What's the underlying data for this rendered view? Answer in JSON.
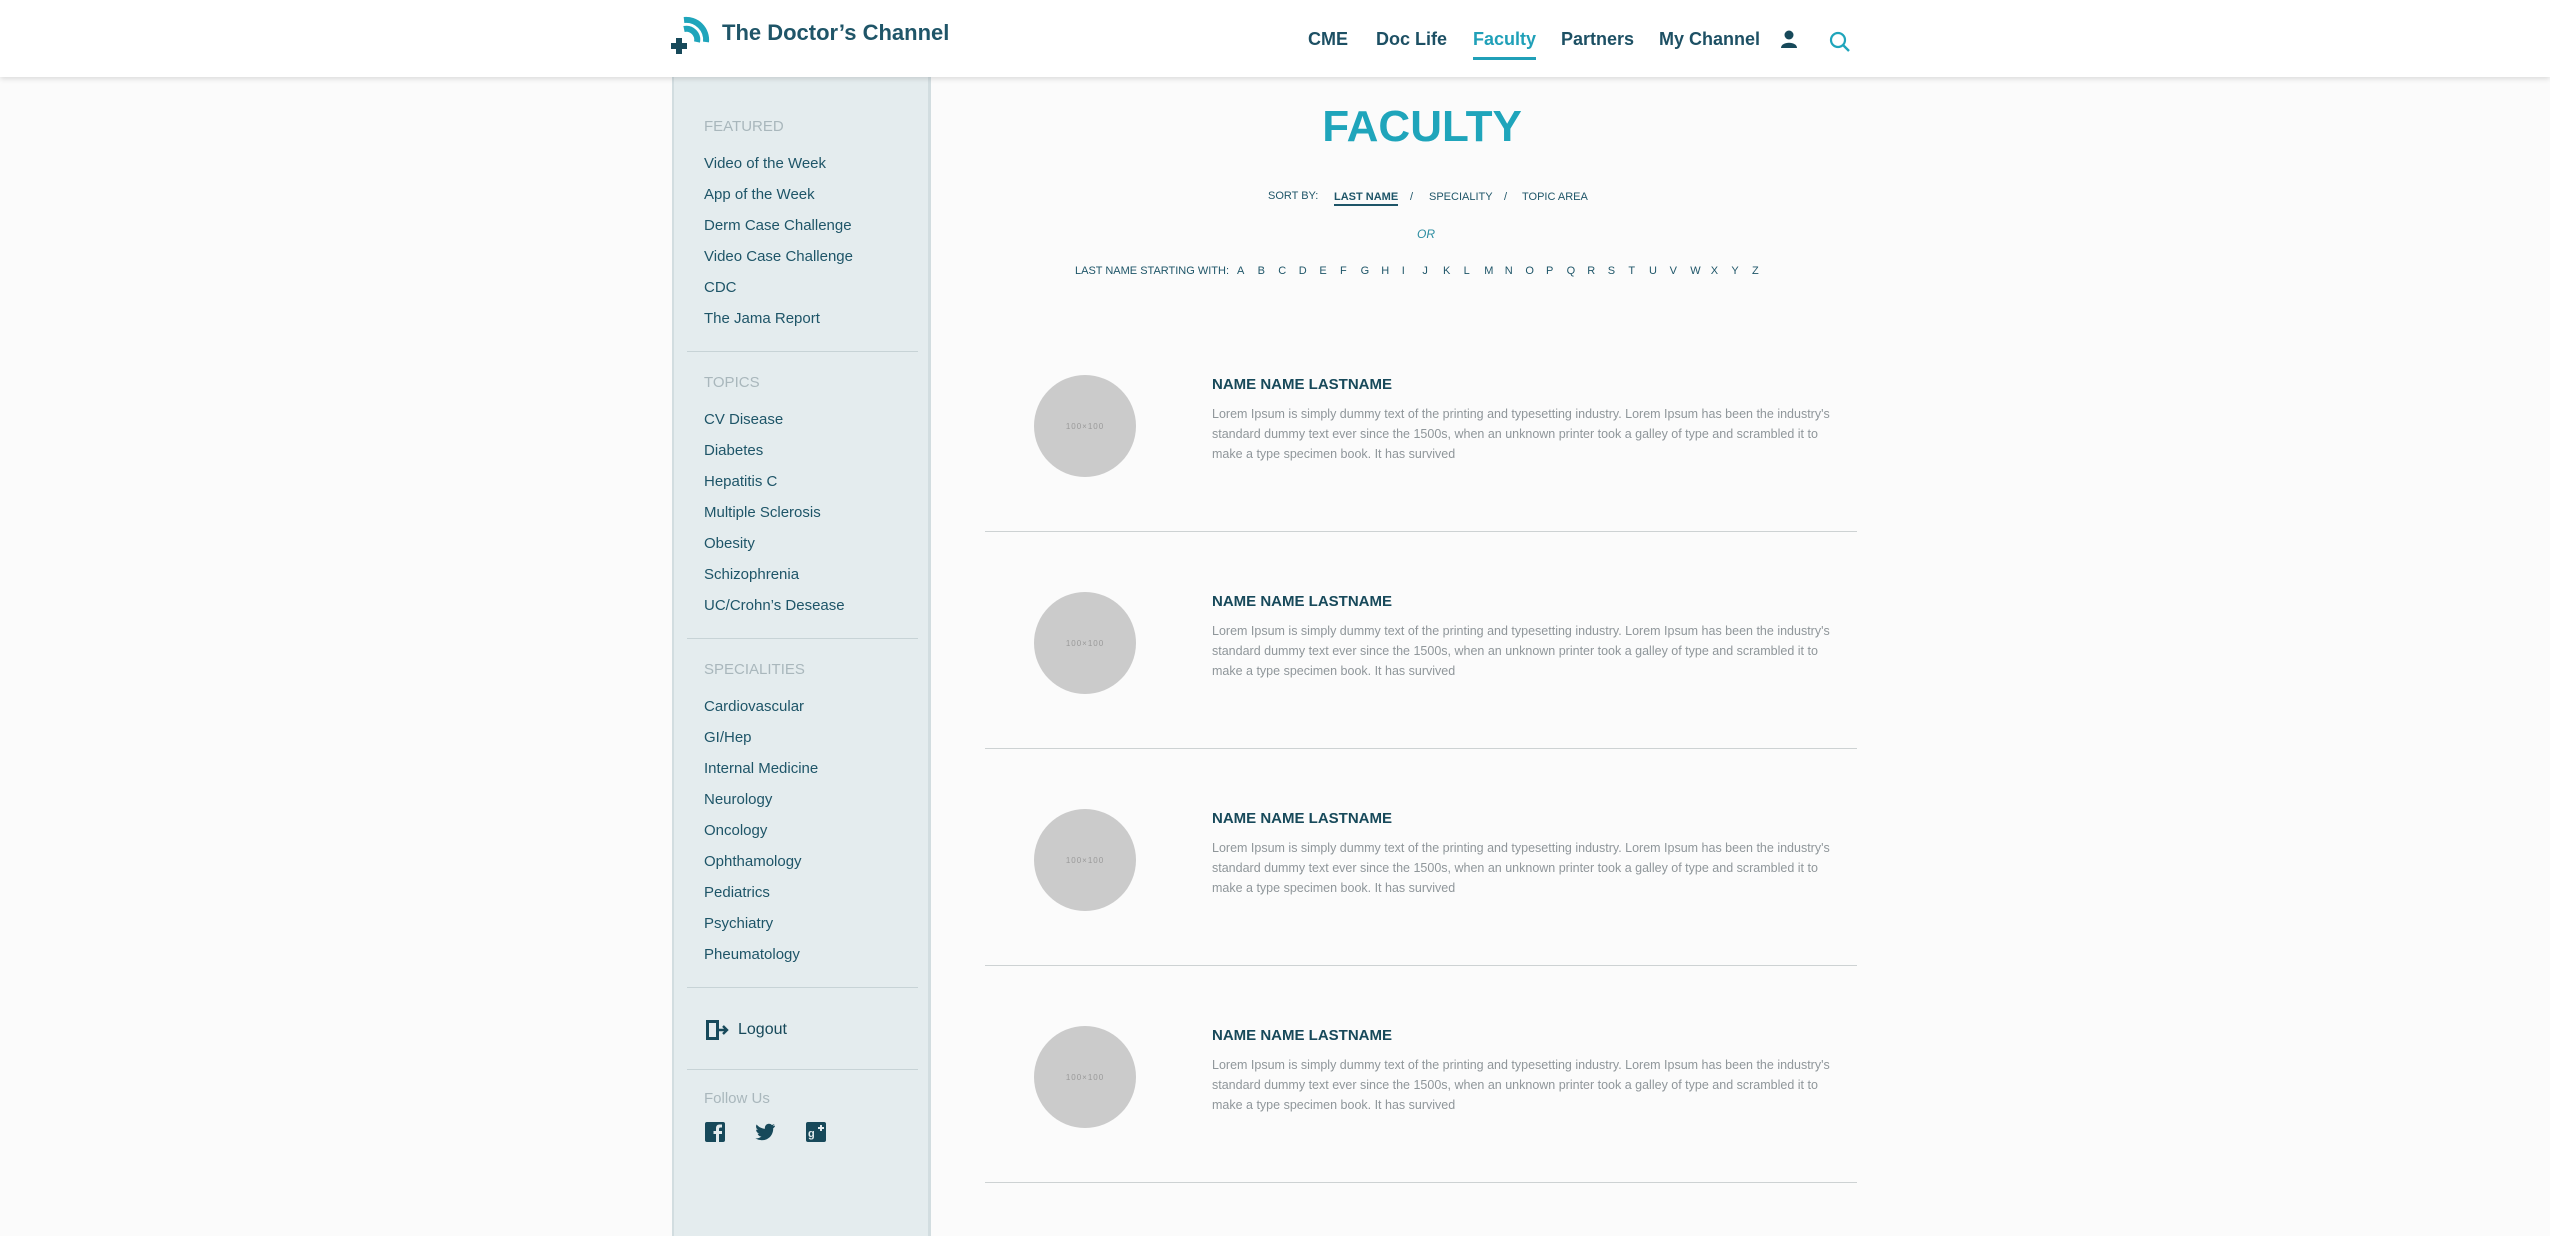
{
  "header": {
    "logo_text": "The Doctor’s Channel",
    "nav": [
      {
        "label": "CME"
      },
      {
        "label": "Doc Life"
      },
      {
        "label": "Faculty",
        "active": true
      },
      {
        "label": "Partners"
      },
      {
        "label": "My Channel"
      }
    ],
    "icons": [
      "user-icon",
      "search-icon"
    ]
  },
  "sidebar": {
    "featured": {
      "heading": "FEATURED",
      "items": [
        "Video of the Week",
        "App of the Week",
        "Derm Case Challenge",
        "Video Case Challenge",
        "CDC",
        "The Jama Report"
      ]
    },
    "topics": {
      "heading": "TOPICS",
      "items": [
        "CV Disease",
        "Diabetes",
        "Hepatitis C",
        "Multiple Sclerosis",
        "Obesity",
        "Schizophrenia",
        "UC/Crohn’s Desease"
      ]
    },
    "specialities": {
      "heading": "SPECIALITIES",
      "items": [
        "Cardiovascular",
        "GI/Hep",
        "Internal Medicine",
        "Neurology",
        "Oncology",
        "Ophthamology",
        "Pediatrics",
        "Psychiatry",
        "Pheumatology"
      ]
    },
    "logout_label": "Logout",
    "follow_label": "Follow Us",
    "social_icons": [
      "facebook-icon",
      "twitter-icon",
      "google-plus-icon"
    ]
  },
  "main": {
    "title": "FACULTY",
    "sort": {
      "label": "SORT BY:",
      "options": [
        {
          "label": "LAST NAME",
          "active": true
        },
        {
          "label": "SPECIALITY"
        },
        {
          "label": "TOPIC AREA"
        }
      ],
      "separator": "/"
    },
    "or_text": "OR",
    "alpha": {
      "label": "LAST NAME STARTING WITH:",
      "letters": [
        "A",
        "B",
        "C",
        "D",
        "E",
        "F",
        "G",
        "H",
        "I",
        "J",
        "K",
        "L",
        "M",
        "N",
        "O",
        "P",
        "Q",
        "R",
        "S",
        "T",
        "U",
        "V",
        "W",
        "X",
        "Y",
        "Z"
      ]
    },
    "faculty": [
      {
        "name": "NAME NAME LASTNAME",
        "avatar_text": "100×100",
        "bio": "Lorem Ipsum is simply dummy text of the printing and typesetting industry. Lorem Ipsum has been the industry's standard dummy text ever since the 1500s, when an unknown printer took a galley of type and scrambled it to make a type specimen book. It has survived"
      },
      {
        "name": "NAME NAME LASTNAME",
        "avatar_text": "100×100",
        "bio": "Lorem Ipsum is simply dummy text of the printing and typesetting industry. Lorem Ipsum has been the industry's standard dummy text ever since the 1500s, when an unknown printer took a galley of type and scrambled it to make a type specimen book. It has survived"
      },
      {
        "name": "NAME NAME LASTNAME",
        "avatar_text": "100×100",
        "bio": "Lorem Ipsum is simply dummy text of the printing and typesetting industry. Lorem Ipsum has been the industry's standard dummy text ever since the 1500s, when an unknown printer took a galley of type and scrambled it to make a type specimen book. It has survived"
      },
      {
        "name": "NAME NAME LASTNAME",
        "avatar_text": "100×100",
        "bio": "Lorem Ipsum is simply dummy text of the printing and typesetting industry. Lorem Ipsum has been the industry's standard dummy text ever since the 1500s, when an unknown printer took a galley of type and scrambled it to make a type specimen book. It has survived"
      }
    ]
  },
  "colors": {
    "accent": "#1fa5bb",
    "text_dark": "#17495a",
    "sidebar_bg": "#e4ecee",
    "muted_heading": "#a9b7bc",
    "avatar_placeholder": "#cbcbcb"
  }
}
